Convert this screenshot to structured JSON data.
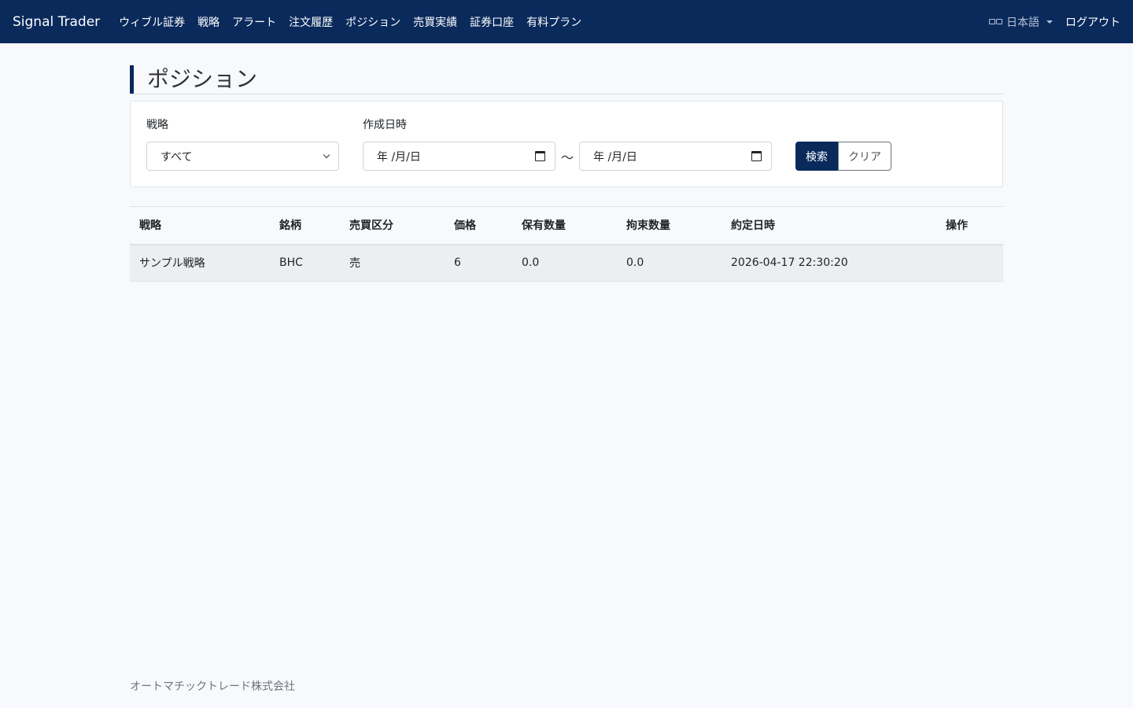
{
  "nav": {
    "brand": "Signal Trader",
    "links": [
      "ウィブル証券",
      "戦略",
      "アラート",
      "注文履歴",
      "ポジション",
      "売買実績",
      "証券口座",
      "有料プラン"
    ],
    "language": "日本語",
    "logout": "ログアウト"
  },
  "page": {
    "title": "ポジション"
  },
  "filters": {
    "strategy_label": "戦略",
    "strategy_value": "すべて",
    "created_label": "作成日時",
    "date_from_placeholder": "年 /月/日",
    "date_to_placeholder": "年 /月/日",
    "range_sep": "〜",
    "search_button": "検索",
    "clear_button": "クリア"
  },
  "table": {
    "headers": [
      "戦略",
      "銘柄",
      "売買区分",
      "価格",
      "保有数量",
      "拘束数量",
      "約定日時",
      "操作"
    ],
    "rows": [
      [
        "サンプル戦略",
        "BHC",
        "売",
        "6",
        "0.0",
        "0.0",
        "2026-04-17 22:30:20",
        ""
      ]
    ]
  },
  "footer": {
    "company": "オートマチックトレード株式会社"
  },
  "colors": {
    "navbar": "#0a2a5c",
    "background": "#f7f9fc",
    "row_bg": "#eceef1"
  }
}
